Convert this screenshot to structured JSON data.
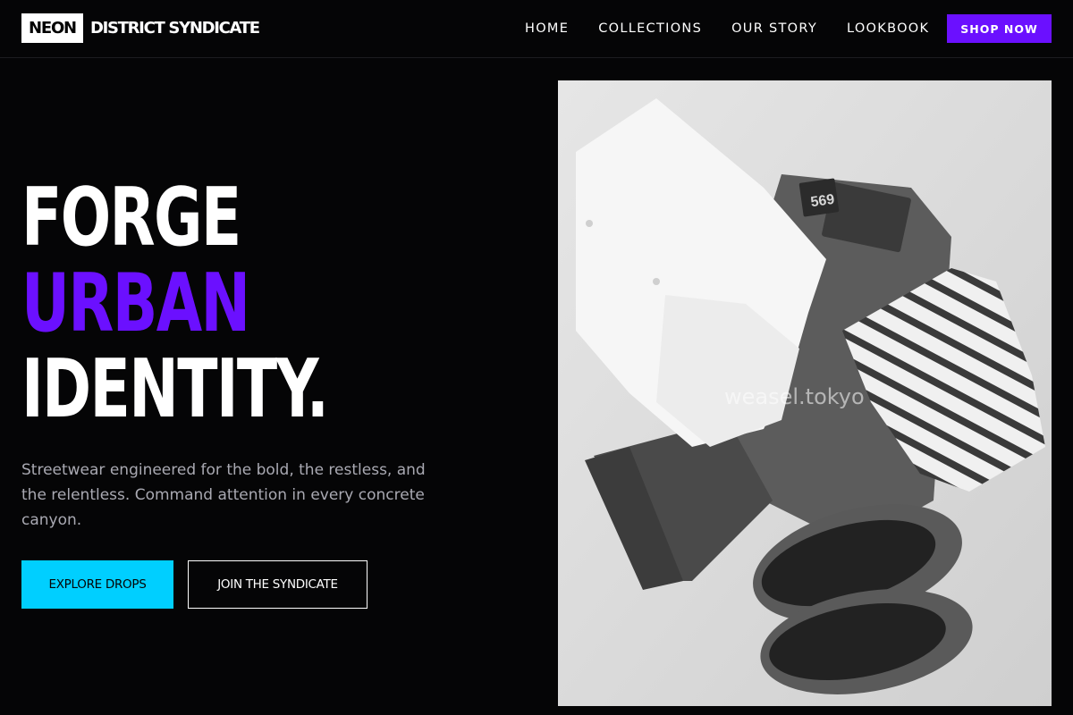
{
  "header": {
    "logo_box": "NEON",
    "logo_rest": "DISTRICT SYNDICATE",
    "nav": [
      "HOME",
      "COLLECTIONS",
      "OUR STORY",
      "LOOKBOOK"
    ],
    "cta": "SHOP NOW"
  },
  "hero": {
    "line1": "FORGE",
    "line2": "URBAN",
    "line3": "IDENTITY.",
    "subtitle": "Streetwear engineered for the bold, the restless, and the relentless. Command attention in every concrete canyon.",
    "primary_button": "EXPLORE DROPS",
    "secondary_button": "JOIN THE SYNDICATE"
  },
  "photo": {
    "patch_number": "569",
    "watermark": "weasel.tokyo"
  },
  "colors": {
    "background": "#050506",
    "accent_purple": "#6b10ff",
    "accent_cyan": "#00cfff",
    "muted_text": "#a9a9b2"
  }
}
